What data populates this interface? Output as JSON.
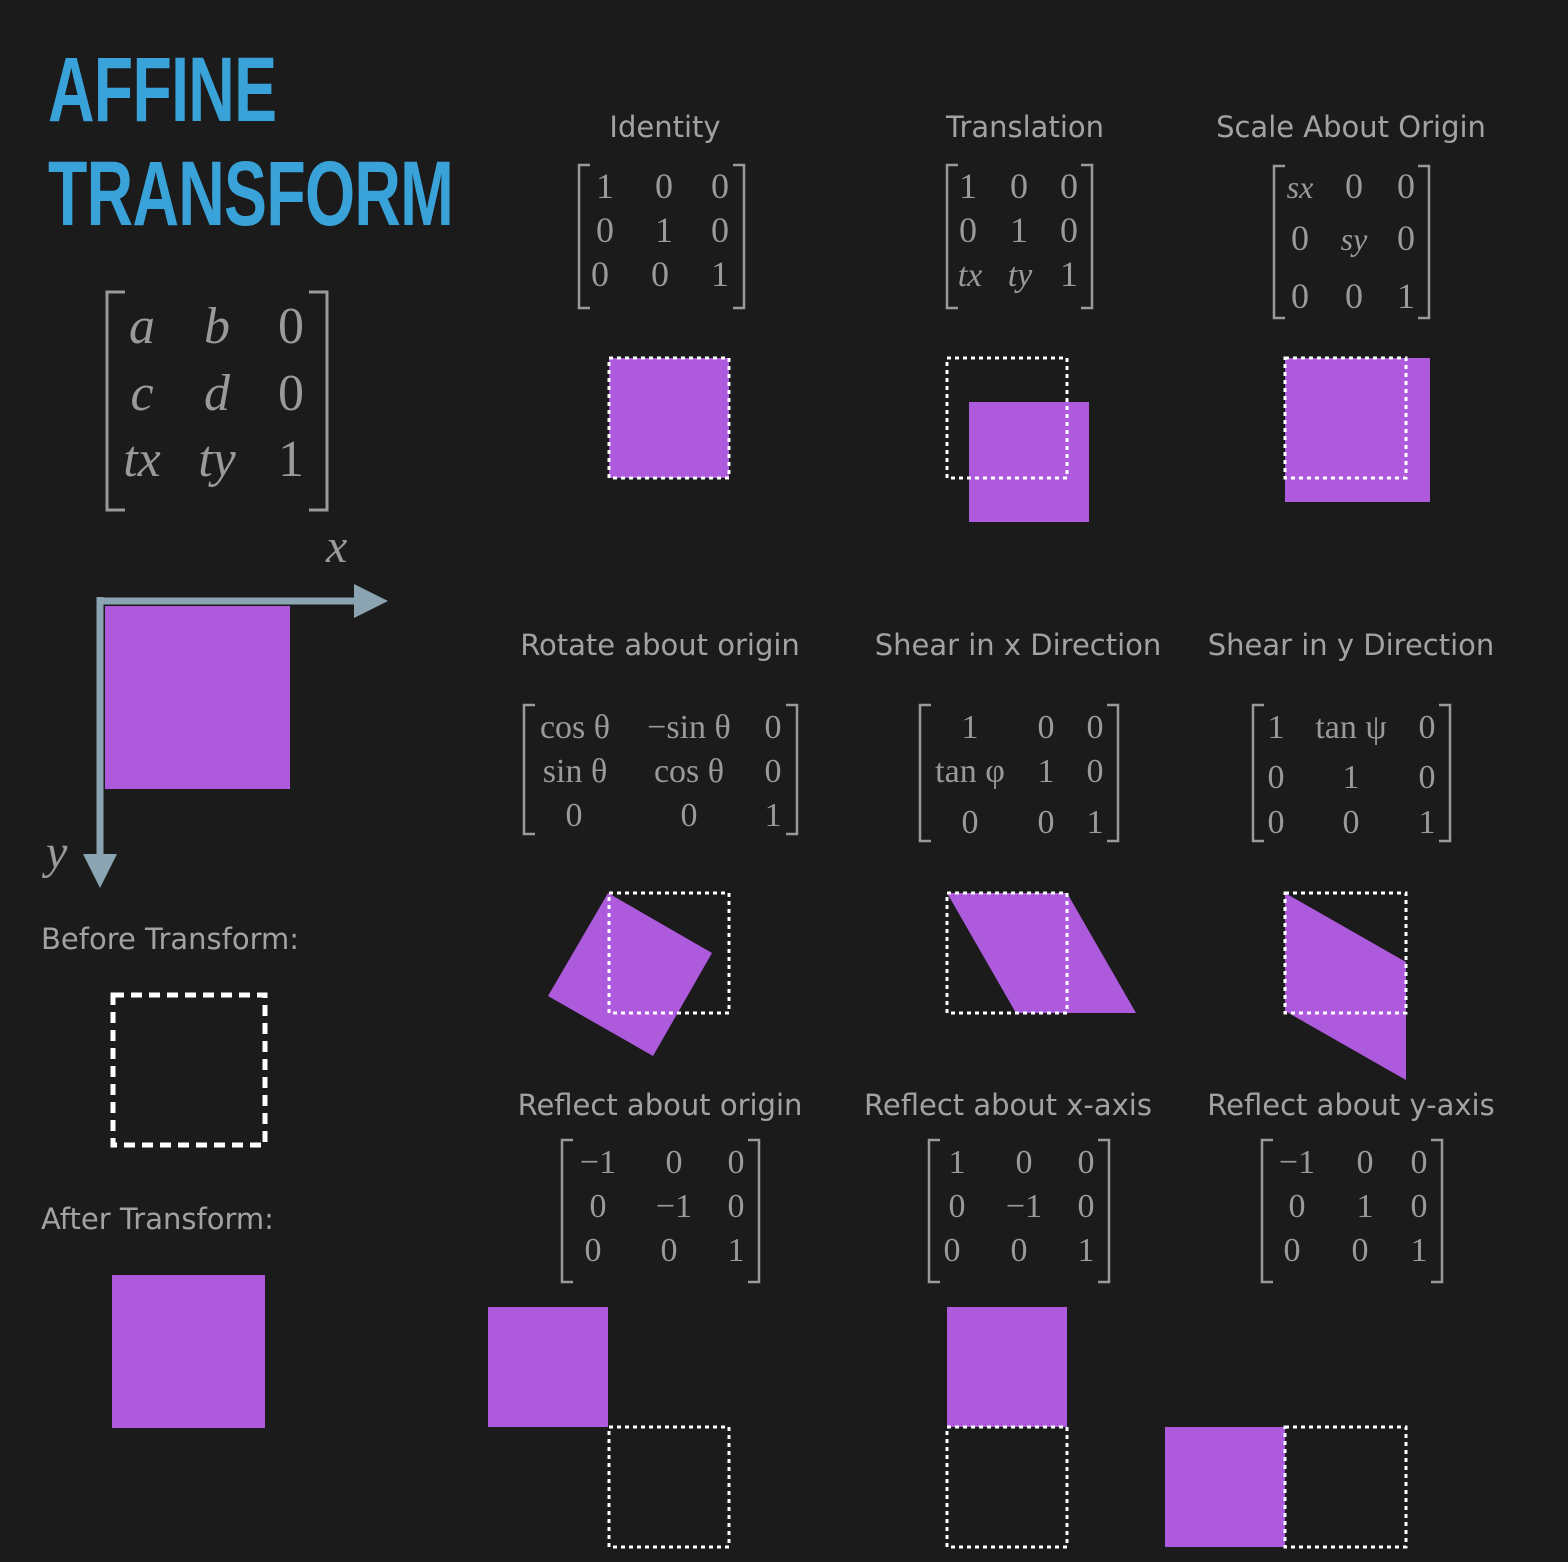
{
  "title": {
    "line1": "AFFINE",
    "line2": "TRANSFORM"
  },
  "colors": {
    "title": "#39a3d9",
    "fill": "#ad5bdc",
    "axis": "#8aa4b1",
    "text": "#a2a2a2",
    "background": "#1b1b1c",
    "outline": "#ffffff"
  },
  "general_matrix": [
    [
      "a",
      "b",
      "0"
    ],
    [
      "c",
      "d",
      "0"
    ],
    [
      "tx",
      "ty",
      "1"
    ]
  ],
  "axes": {
    "x_label": "x",
    "y_label": "y"
  },
  "legend": {
    "before_label": "Before Transform:",
    "after_label": "After Transform:"
  },
  "transforms": [
    {
      "name": "Identity",
      "matrix": [
        [
          "1",
          "0",
          "0"
        ],
        [
          "0",
          "1",
          "0"
        ],
        [
          "0",
          "0",
          "1"
        ]
      ]
    },
    {
      "name": "Translation",
      "matrix": [
        [
          "1",
          "0",
          "0"
        ],
        [
          "0",
          "1",
          "0"
        ],
        [
          "tx",
          "ty",
          "1"
        ]
      ]
    },
    {
      "name": "Scale About Origin",
      "matrix": [
        [
          "sx",
          "0",
          "0"
        ],
        [
          "0",
          "sy",
          "0"
        ],
        [
          "0",
          "0",
          "1"
        ]
      ]
    },
    {
      "name": "Rotate about origin",
      "matrix": [
        [
          "cos θ",
          "−sin θ",
          "0"
        ],
        [
          "sin θ",
          "cos θ",
          "0"
        ],
        [
          "0",
          "0",
          "1"
        ]
      ]
    },
    {
      "name": "Shear in x Direction",
      "matrix": [
        [
          "1",
          "0",
          "0"
        ],
        [
          "tan φ",
          "1",
          "0"
        ],
        [
          "0",
          "0",
          "1"
        ]
      ]
    },
    {
      "name": "Shear in y Direction",
      "matrix": [
        [
          "1",
          "tan ψ",
          "0"
        ],
        [
          "0",
          "1",
          "0"
        ],
        [
          "0",
          "0",
          "1"
        ]
      ]
    },
    {
      "name": "Reflect about origin",
      "matrix": [
        [
          "−1",
          "0",
          "0"
        ],
        [
          "0",
          "−1",
          "0"
        ],
        [
          "0",
          "0",
          "1"
        ]
      ]
    },
    {
      "name": "Reflect about x-axis",
      "matrix": [
        [
          "1",
          "0",
          "0"
        ],
        [
          "0",
          "−1",
          "0"
        ],
        [
          "0",
          "0",
          "1"
        ]
      ]
    },
    {
      "name": "Reflect about y-axis",
      "matrix": [
        [
          "−1",
          "0",
          "0"
        ],
        [
          "0",
          "1",
          "0"
        ],
        [
          "0",
          "0",
          "1"
        ]
      ]
    }
  ]
}
